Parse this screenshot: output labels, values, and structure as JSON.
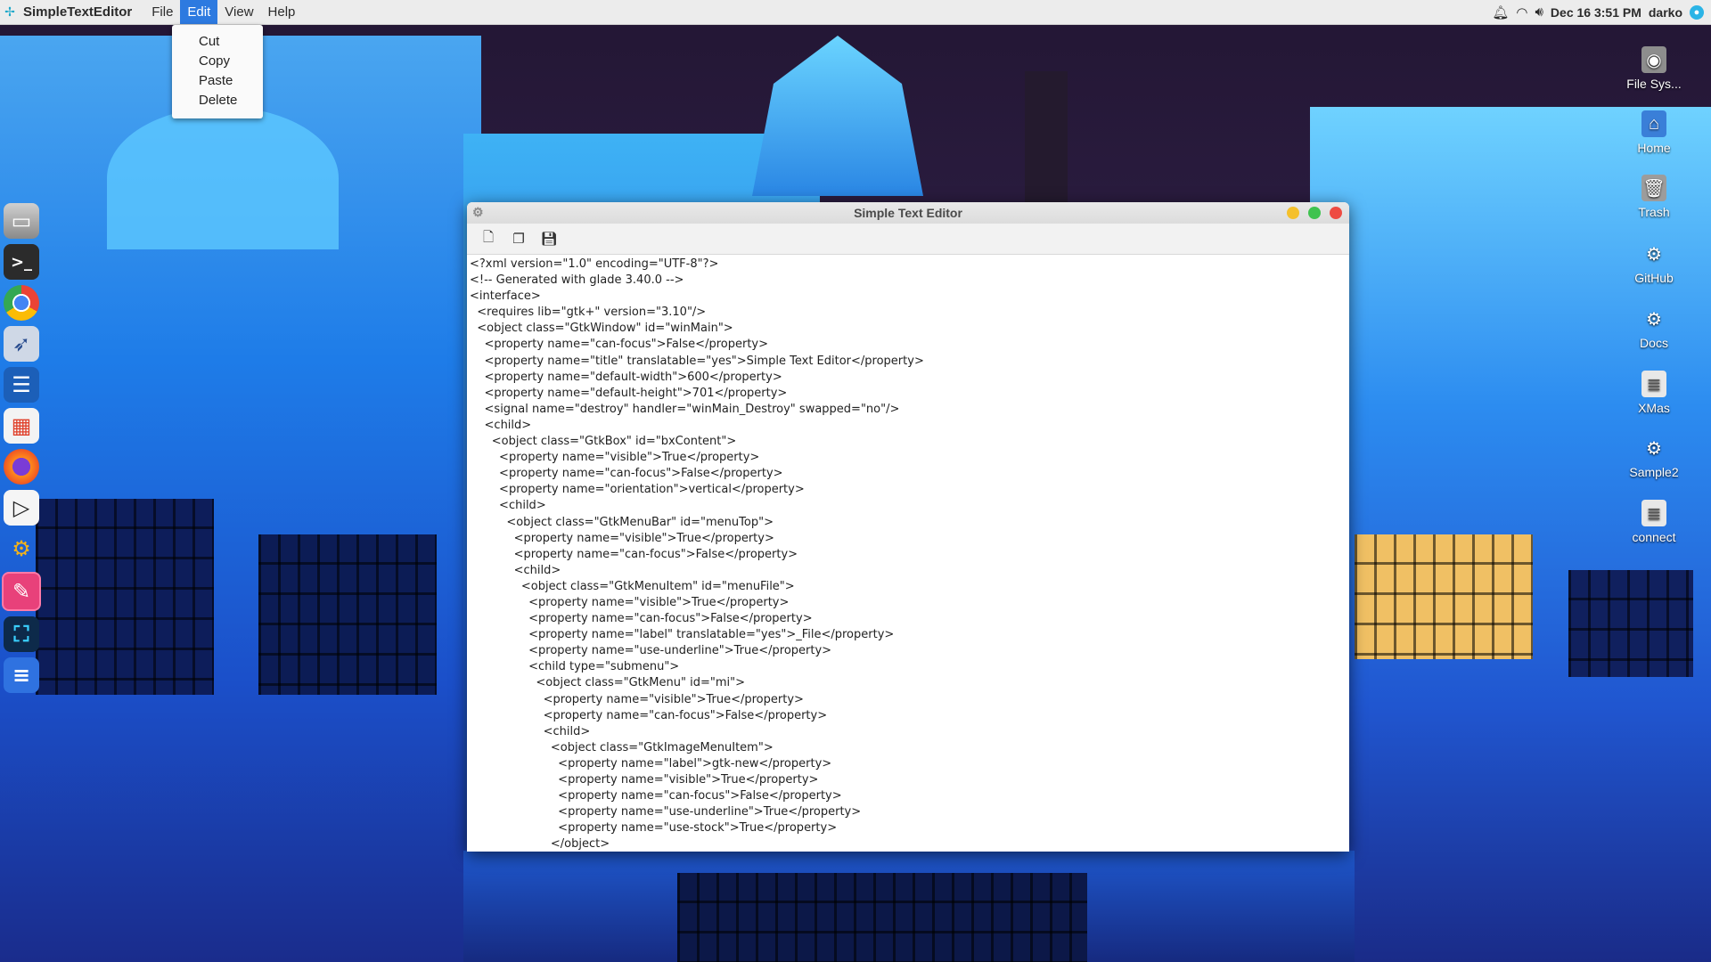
{
  "top_panel": {
    "app_name": "SimpleTextEditor",
    "menus": [
      "File",
      "Edit",
      "View",
      "Help"
    ],
    "active_menu": "Edit",
    "datetime": "Dec 16  3:51 PM",
    "user": "darko",
    "status_icons": [
      "bell-icon",
      "wifi-icon",
      "volume-icon"
    ]
  },
  "edit_menu": {
    "items": [
      "Cut",
      "Copy",
      "Paste",
      "Delete"
    ]
  },
  "dock": {
    "items": [
      "files-icon",
      "terminal-icon",
      "chrome-icon",
      "feather-icon",
      "document-viewer-icon",
      "app-store-icon",
      "firefox-icon",
      "media-player-icon",
      "robot-arm-icon",
      "text-editor-icon",
      "screenshot-icon",
      "docs-icon"
    ]
  },
  "desktop_icons": [
    {
      "label": "File Sys...",
      "icon": "drive-icon"
    },
    {
      "label": "Home",
      "icon": "home-folder-icon"
    },
    {
      "label": "Trash",
      "icon": "trash-icon"
    },
    {
      "label": "GitHub",
      "icon": "folder-link-icon"
    },
    {
      "label": "Docs",
      "icon": "folder-link-icon"
    },
    {
      "label": "XMas",
      "icon": "text-file-icon"
    },
    {
      "label": "Sample2",
      "icon": "folder-link-icon"
    },
    {
      "label": "connect",
      "icon": "text-file-icon"
    }
  ],
  "editor": {
    "title": "Simple Text Editor",
    "toolbar": [
      "new-file-icon",
      "open-file-icon",
      "save-file-icon"
    ],
    "content": "<?xml version=\"1.0\" encoding=\"UTF-8\"?>\n<!-- Generated with glade 3.40.0 -->\n<interface>\n  <requires lib=\"gtk+\" version=\"3.10\"/>\n  <object class=\"GtkWindow\" id=\"winMain\">\n    <property name=\"can-focus\">False</property>\n    <property name=\"title\" translatable=\"yes\">Simple Text Editor</property>\n    <property name=\"default-width\">600</property>\n    <property name=\"default-height\">701</property>\n    <signal name=\"destroy\" handler=\"winMain_Destroy\" swapped=\"no\"/>\n    <child>\n      <object class=\"GtkBox\" id=\"bxContent\">\n        <property name=\"visible\">True</property>\n        <property name=\"can-focus\">False</property>\n        <property name=\"orientation\">vertical</property>\n        <child>\n          <object class=\"GtkMenuBar\" id=\"menuTop\">\n            <property name=\"visible\">True</property>\n            <property name=\"can-focus\">False</property>\n            <child>\n              <object class=\"GtkMenuItem\" id=\"menuFile\">\n                <property name=\"visible\">True</property>\n                <property name=\"can-focus\">False</property>\n                <property name=\"label\" translatable=\"yes\">_File</property>\n                <property name=\"use-underline\">True</property>\n                <child type=\"submenu\">\n                  <object class=\"GtkMenu\" id=\"mi\">\n                    <property name=\"visible\">True</property>\n                    <property name=\"can-focus\">False</property>\n                    <child>\n                      <object class=\"GtkImageMenuItem\">\n                        <property name=\"label\">gtk-new</property>\n                        <property name=\"visible\">True</property>\n                        <property name=\"can-focus\">False</property>\n                        <property name=\"use-underline\">True</property>\n                        <property name=\"use-stock\">True</property>\n                      </object>"
  }
}
